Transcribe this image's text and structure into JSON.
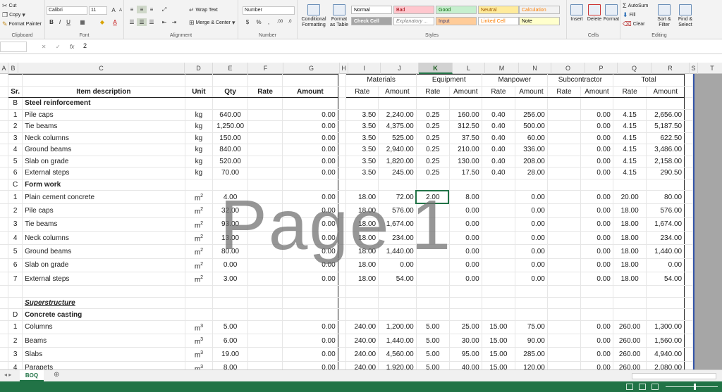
{
  "ribbon": {
    "clipboard": {
      "cut": "Cut",
      "copy": "Copy",
      "format_painter": "Format Painter",
      "group": "Clipboard"
    },
    "font": {
      "name": "Calibri",
      "size": "11",
      "group": "Font"
    },
    "alignment": {
      "wrap": "Wrap Text",
      "merge": "Merge & Center",
      "group": "Alignment"
    },
    "number": {
      "format": "Number",
      "group": "Number"
    },
    "styles": {
      "conditional": "Conditional Formatting",
      "format_table": "Format as Table",
      "cells": [
        {
          "label": "Normal",
          "bg": "#ffffff",
          "fg": "#000000"
        },
        {
          "label": "Bad",
          "bg": "#ffc7ce",
          "fg": "#9c0006"
        },
        {
          "label": "Good",
          "bg": "#c6efce",
          "fg": "#006100"
        },
        {
          "label": "Neutral",
          "bg": "#ffeb9c",
          "fg": "#9c5700"
        },
        {
          "label": "Calculation",
          "bg": "#f2f2f2",
          "fg": "#fa7d00"
        },
        {
          "label": "Check Cell",
          "bg": "#a5a5a5",
          "fg": "#ffffff"
        },
        {
          "label": "Explanatory ...",
          "bg": "#ffffff",
          "fg": "#7f7f7f"
        },
        {
          "label": "Input",
          "bg": "#ffcc99",
          "fg": "#3f3f76"
        },
        {
          "label": "Linked Cell",
          "bg": "#ffffff",
          "fg": "#fa7d00"
        },
        {
          "label": "Note",
          "bg": "#ffffcc",
          "fg": "#000000"
        }
      ],
      "group": "Styles"
    },
    "cells": {
      "insert": "Insert",
      "delete": "Delete",
      "format": "Format",
      "group": "Cells"
    },
    "editing": {
      "autosum": "AutoSum",
      "fill": "Fill",
      "clear": "Clear",
      "sort": "Sort & Filter",
      "find": "Find & Select",
      "group": "Editing"
    }
  },
  "formula_bar": {
    "name_box": "",
    "fx": "fx",
    "value": "2"
  },
  "columns": [
    "A",
    "B",
    "C",
    "D",
    "E",
    "F",
    "G",
    "H",
    "I",
    "J",
    "K",
    "L",
    "M",
    "N",
    "O",
    "P",
    "Q",
    "R",
    "S",
    "T"
  ],
  "selected_column": "K",
  "header_groups": {
    "materials": "Materials",
    "equipment": "Equipment",
    "manpower": "Manpower",
    "subcontractor": "Subcontractor",
    "total": "Total"
  },
  "headers": {
    "sr": "Sr.",
    "item": "Item description",
    "unit": "Unit",
    "qty": "Qty",
    "rate": "Rate",
    "amount": "Amount"
  },
  "rows": [
    {
      "sr": "B",
      "desc": "Steel reinforcement",
      "type": "section"
    },
    {
      "sr": "1",
      "desc": "Pile caps",
      "unit": "kg",
      "qty": "640.00",
      "amt": "0.00",
      "mr": "3.50",
      "ma": "2,240.00",
      "er": "0.25",
      "ea": "160.00",
      "pr": "0.40",
      "pa": "256.00",
      "sa": "0.00",
      "tr": "4.15",
      "ta": "2,656.00"
    },
    {
      "sr": "2",
      "desc": "Tie beams",
      "unit": "kg",
      "qty": "1,250.00",
      "amt": "0.00",
      "mr": "3.50",
      "ma": "4,375.00",
      "er": "0.25",
      "ea": "312.50",
      "pr": "0.40",
      "pa": "500.00",
      "sa": "0.00",
      "tr": "4.15",
      "ta": "5,187.50"
    },
    {
      "sr": "3",
      "desc": "Neck columns",
      "unit": "kg",
      "qty": "150.00",
      "amt": "0.00",
      "mr": "3.50",
      "ma": "525.00",
      "er": "0.25",
      "ea": "37.50",
      "pr": "0.40",
      "pa": "60.00",
      "sa": "0.00",
      "tr": "4.15",
      "ta": "622.50"
    },
    {
      "sr": "4",
      "desc": "Ground beams",
      "unit": "kg",
      "qty": "840.00",
      "amt": "0.00",
      "mr": "3.50",
      "ma": "2,940.00",
      "er": "0.25",
      "ea": "210.00",
      "pr": "0.40",
      "pa": "336.00",
      "sa": "0.00",
      "tr": "4.15",
      "ta": "3,486.00"
    },
    {
      "sr": "5",
      "desc": "Slab on grade",
      "unit": "kg",
      "qty": "520.00",
      "amt": "0.00",
      "mr": "3.50",
      "ma": "1,820.00",
      "er": "0.25",
      "ea": "130.00",
      "pr": "0.40",
      "pa": "208.00",
      "sa": "0.00",
      "tr": "4.15",
      "ta": "2,158.00"
    },
    {
      "sr": "6",
      "desc": "External steps",
      "unit": "kg",
      "qty": "70.00",
      "amt": "0.00",
      "mr": "3.50",
      "ma": "245.00",
      "er": "0.25",
      "ea": "17.50",
      "pr": "0.40",
      "pa": "28.00",
      "sa": "0.00",
      "tr": "4.15",
      "ta": "290.50"
    },
    {
      "sr": "C",
      "desc": "Form work",
      "type": "section"
    },
    {
      "sr": "1",
      "desc": "Plain cement concrete",
      "unit": "m",
      "sup": "2",
      "qty": "4.00",
      "amt": "0.00",
      "mr": "18.00",
      "ma": "72.00",
      "er": "2.00",
      "ea": "8.00",
      "pr": "",
      "pa": "0.00",
      "sa": "0.00",
      "tr": "20.00",
      "ta": "80.00"
    },
    {
      "sr": "2",
      "desc": "Pile caps",
      "unit": "m",
      "sup": "2",
      "qty": "32.00",
      "amt": "0.00",
      "mr": "18.00",
      "ma": "576.00",
      "er": "",
      "ea": "0.00",
      "pr": "",
      "pa": "0.00",
      "sa": "0.00",
      "tr": "18.00",
      "ta": "576.00"
    },
    {
      "sr": "3",
      "desc": "Tie beams",
      "unit": "m",
      "sup": "2",
      "qty": "93.00",
      "amt": "0.00",
      "mr": "18.00",
      "ma": "1,674.00",
      "er": "",
      "ea": "0.00",
      "pr": "",
      "pa": "0.00",
      "sa": "0.00",
      "tr": "18.00",
      "ta": "1,674.00"
    },
    {
      "sr": "4",
      "desc": "Neck columns",
      "unit": "m",
      "sup": "2",
      "qty": "13.00",
      "amt": "0.00",
      "mr": "18.00",
      "ma": "234.00",
      "er": "",
      "ea": "0.00",
      "pr": "",
      "pa": "0.00",
      "sa": "0.00",
      "tr": "18.00",
      "ta": "234.00"
    },
    {
      "sr": "5",
      "desc": "Ground beams",
      "unit": "m",
      "sup": "2",
      "qty": "80.00",
      "amt": "0.00",
      "mr": "18.00",
      "ma": "1,440.00",
      "er": "",
      "ea": "0.00",
      "pr": "",
      "pa": "0.00",
      "sa": "0.00",
      "tr": "18.00",
      "ta": "1,440.00"
    },
    {
      "sr": "6",
      "desc": "Slab on grade",
      "unit": "m",
      "sup": "2",
      "qty": "0.00",
      "amt": "0.00",
      "mr": "18.00",
      "ma": "0.00",
      "er": "",
      "ea": "0.00",
      "pr": "",
      "pa": "0.00",
      "sa": "0.00",
      "tr": "18.00",
      "ta": "0.00"
    },
    {
      "sr": "7",
      "desc": "External steps",
      "unit": "m",
      "sup": "2",
      "qty": "3.00",
      "amt": "0.00",
      "mr": "18.00",
      "ma": "54.00",
      "er": "",
      "ea": "0.00",
      "pr": "",
      "pa": "0.00",
      "sa": "0.00",
      "tr": "18.00",
      "ta": "54.00"
    },
    {
      "sr": "",
      "desc": "",
      "type": "blank"
    },
    {
      "sr": "",
      "desc": "Superstructure",
      "type": "subsection"
    },
    {
      "sr": "D",
      "desc": "Concrete casting",
      "type": "section"
    },
    {
      "sr": "1",
      "desc": "Columns",
      "unit": "m",
      "sup": "3",
      "qty": "5.00",
      "amt": "0.00",
      "mr": "240.00",
      "ma": "1,200.00",
      "er": "5.00",
      "ea": "25.00",
      "pr": "15.00",
      "pa": "75.00",
      "sa": "0.00",
      "tr": "260.00",
      "ta": "1,300.00"
    },
    {
      "sr": "2",
      "desc": "Beams",
      "unit": "m",
      "sup": "3",
      "qty": "6.00",
      "amt": "0.00",
      "mr": "240.00",
      "ma": "1,440.00",
      "er": "5.00",
      "ea": "30.00",
      "pr": "15.00",
      "pa": "90.00",
      "sa": "0.00",
      "tr": "260.00",
      "ta": "1,560.00"
    },
    {
      "sr": "3",
      "desc": "Slabs",
      "unit": "m",
      "sup": "3",
      "qty": "19.00",
      "amt": "0.00",
      "mr": "240.00",
      "ma": "4,560.00",
      "er": "5.00",
      "ea": "95.00",
      "pr": "15.00",
      "pa": "285.00",
      "sa": "0.00",
      "tr": "260.00",
      "ta": "4,940.00"
    },
    {
      "sr": "4",
      "desc": "Parapets",
      "unit": "m",
      "sup": "3",
      "qty": "8.00",
      "amt": "0.00",
      "mr": "240.00",
      "ma": "1,920.00",
      "er": "5.00",
      "ea": "40.00",
      "pr": "15.00",
      "pa": "120.00",
      "sa": "0.00",
      "tr": "260.00",
      "ta": "2,080.00"
    }
  ],
  "watermark": "Page 1",
  "sheet_tab": "BOQ"
}
